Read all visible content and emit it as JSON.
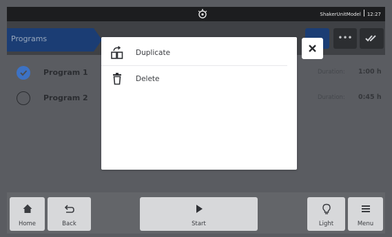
{
  "status": {
    "model": "ShakerUnitModel",
    "time": "12:27"
  },
  "header": {
    "title": "Programs",
    "more_label": "•••"
  },
  "programs": [
    {
      "name": "Program 1",
      "selected": true,
      "duration_label": "Duration:",
      "duration": "1:00 h"
    },
    {
      "name": "Program 2",
      "selected": false,
      "duration_label": "Duration:",
      "duration": "0:45 h"
    }
  ],
  "popup": {
    "items": [
      {
        "label": "Duplicate",
        "icon": "duplicate-icon"
      },
      {
        "label": "Delete",
        "icon": "trash-icon"
      }
    ],
    "close_icon": "close-icon"
  },
  "nav": {
    "home": "Home",
    "back": "Back",
    "start": "Start",
    "light": "Light",
    "menu": "Menu"
  },
  "colors": {
    "accent": "#3d72c4",
    "header_active": "#1b3d74",
    "status_bar": "#1c1d1f"
  }
}
